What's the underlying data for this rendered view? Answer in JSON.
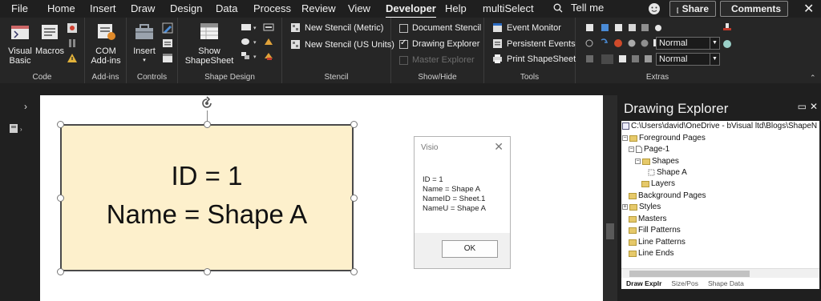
{
  "menu": {
    "tabs": [
      "File",
      "Home",
      "Insert",
      "Draw",
      "Design",
      "Data",
      "Process",
      "Review",
      "View",
      "Developer",
      "Help",
      "multiSelect"
    ],
    "active_tab": "Developer",
    "tell_me": "Tell me",
    "share": "Share",
    "comments": "Comments"
  },
  "ribbon": {
    "code": {
      "visual_basic": "Visual Basic",
      "macros": "Macros",
      "label": "Code"
    },
    "addins": {
      "com_addins": "COM Add-ins",
      "label": "Add-ins"
    },
    "controls": {
      "insert": "Insert",
      "label": "Controls"
    },
    "shape_design": {
      "show_shapesheet": "Show ShapeSheet",
      "label": "Shape Design"
    },
    "stencil": {
      "new_metric": "New Stencil (Metric)",
      "new_us": "New Stencil (US Units)",
      "label": "Stencil"
    },
    "show_hide": {
      "document_stencil": "Document Stencil",
      "drawing_explorer": "Drawing Explorer",
      "master_explorer": "Master Explorer",
      "label": "Show/Hide",
      "document_stencil_checked": false,
      "drawing_explorer_checked": true,
      "master_explorer_checked": false
    },
    "tools": {
      "event_monitor": "Event Monitor",
      "persistent_events": "Persistent Events",
      "print_shapesheet": "Print ShapeSheet",
      "label": "Tools"
    },
    "extras": {
      "style1": "Normal",
      "style2": "Normal",
      "label": "Extras"
    }
  },
  "shape": {
    "line1": "ID = 1",
    "line2": "Name = Shape A"
  },
  "msgbox": {
    "title": "Visio",
    "lines": [
      "ID = 1",
      "Name = Shape A",
      "NameID = Sheet.1",
      "NameU = Shape A"
    ],
    "ok": "OK"
  },
  "explorer": {
    "title": "Drawing Explorer",
    "path": "C:\\Users\\david\\OneDrive - bVisual ltd\\Blogs\\ShapeN",
    "nodes": [
      "Foreground Pages",
      "Page-1",
      "Shapes",
      "Shape A",
      "Layers",
      "Background Pages",
      "Styles",
      "Masters",
      "Fill Patterns",
      "Line Patterns",
      "Line Ends"
    ],
    "tabs": [
      "Draw Explr",
      "Size/Pos",
      "Shape Data"
    ]
  },
  "colors": {
    "shape_fill": "#fdf0cc",
    "ribbon_bg": "#262626",
    "app_bg": "#1f1f1f"
  }
}
